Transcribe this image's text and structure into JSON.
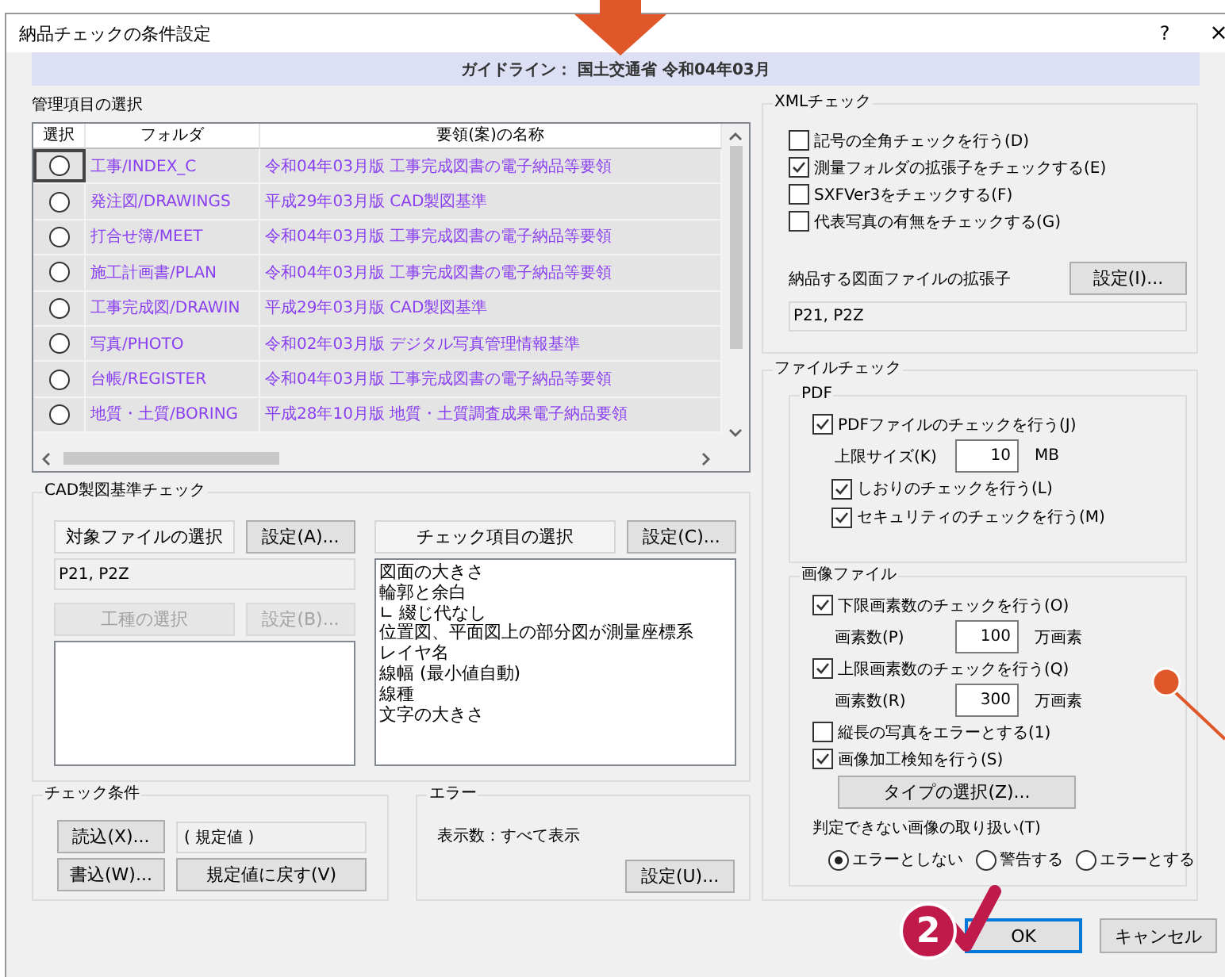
{
  "window": {
    "title": "納品チェックの条件設定",
    "help_button": "?",
    "close_button": "×"
  },
  "guideline": "ガイドライン： 国土交通省 令和04年03月",
  "management": {
    "title": "管理項目の選択",
    "columns": [
      "選択",
      "フォルダ",
      "要領(案)の名称"
    ],
    "rows": [
      {
        "selected": false,
        "focused": true,
        "folder": "工事/INDEX_C",
        "standard": "令和04年03月版 工事完成図書の電子納品等要領"
      },
      {
        "selected": false,
        "focused": false,
        "folder": "発注図/DRAWINGS",
        "standard": "平成29年03月版 CAD製図基準"
      },
      {
        "selected": false,
        "focused": false,
        "folder": "打合せ簿/MEET",
        "standard": "令和04年03月版 工事完成図書の電子納品等要領"
      },
      {
        "selected": false,
        "focused": false,
        "folder": "施工計画書/PLAN",
        "standard": "令和04年03月版 工事完成図書の電子納品等要領"
      },
      {
        "selected": false,
        "focused": false,
        "folder": "工事完成図/DRAWIN",
        "standard": "平成29年03月版 CAD製図基準"
      },
      {
        "selected": false,
        "focused": false,
        "folder": "写真/PHOTO",
        "standard": "令和02年03月版 デジタル写真管理情報基準"
      },
      {
        "selected": false,
        "focused": false,
        "folder": "台帳/REGISTER",
        "standard": "令和04年03月版 工事完成図書の電子納品等要領"
      },
      {
        "selected": false,
        "focused": false,
        "folder": "地質・土質/BORING",
        "standard": "平成28年10月版 地質・土質調査成果電子納品要領"
      }
    ]
  },
  "cad": {
    "title": "CAD製図基準チェック",
    "target_select": {
      "label": "対象ファイルの選択",
      "disabled": false
    },
    "target_settings": {
      "label": "設定(A)...",
      "disabled": false
    },
    "target_value": "P21, P2Z",
    "work_select": {
      "label": "工種の選択",
      "disabled": true
    },
    "work_settings": {
      "label": "設定(B)...",
      "disabled": true
    },
    "check_select": {
      "label": "チェック項目の選択",
      "disabled": false
    },
    "check_settings": {
      "label": "設定(C)...",
      "disabled": false
    },
    "check_items": [
      "図面の大きさ",
      "輪郭と余白",
      "∟ 綴じ代なし",
      "位置図、平面図上の部分図が測量座標系",
      "レイヤ名",
      "線幅 (最小値自動)",
      "線種",
      "文字の大きさ"
    ]
  },
  "conditions": {
    "title": "チェック条件",
    "read_button": "読込(X)...",
    "current": "( 規定値 )",
    "write_button": "書込(W)...",
    "reset_button": "規定値に戻す(V)"
  },
  "error": {
    "title": "エラー",
    "display": "表示数：すべて表示",
    "settings_button": "設定(U)..."
  },
  "xml": {
    "title": "XMLチェック",
    "options": [
      {
        "label": "記号の全角チェックを行う(D)",
        "checked": false
      },
      {
        "label": "測量フォルダの拡張子をチェックする(E)",
        "checked": true
      },
      {
        "label": "SXFVer3をチェックする(F)",
        "checked": false
      },
      {
        "label": "代表写真の有無をチェックする(G)",
        "checked": false
      }
    ],
    "extension_label": "納品する図面ファイルの拡張子",
    "extension_button": "設定(I)...",
    "extension_value": "P21, P2Z"
  },
  "file_check": {
    "title": "ファイルチェック",
    "pdf": {
      "title": "PDF",
      "items": [
        {
          "kind": "checkbox",
          "label": "PDFファイルのチェックを行う(J)",
          "checked": true
        },
        {
          "kind": "field",
          "label": "上限サイズ(K)",
          "value": "10",
          "unit": "MB"
        },
        {
          "kind": "subcheckbox",
          "label": "しおりのチェックを行う(L)",
          "checked": true
        },
        {
          "kind": "subcheckbox",
          "label": "セキュリティのチェックを行う(M)",
          "checked": true
        }
      ]
    },
    "image": {
      "title": "画像ファイル",
      "items": [
        {
          "kind": "checkbox",
          "label": "下限画素数のチェックを行う(O)",
          "checked": true
        },
        {
          "kind": "field",
          "label": "画素数(P)",
          "value": "100",
          "unit": "万画素"
        },
        {
          "kind": "checkbox",
          "label": "上限画素数のチェックを行う(Q)",
          "checked": true
        },
        {
          "kind": "field",
          "label": "画素数(R)",
          "value": "300",
          "unit": "万画素"
        },
        {
          "kind": "checkbox",
          "label": "縦長の写真をエラーとする(1)",
          "checked": false
        },
        {
          "kind": "checkbox",
          "label": "画像加工検知を行う(S)",
          "checked": true
        },
        {
          "kind": "button",
          "label": "タイプの選択(Z)..."
        },
        {
          "kind": "radios",
          "label": "判定できない画像の取り扱い(T)",
          "options": [
            {
              "label": "エラーとしない",
              "selected": true
            },
            {
              "label": "警告する",
              "selected": false
            },
            {
              "label": "エラーとする",
              "selected": false
            }
          ]
        }
      ]
    }
  },
  "buttons": [
    {
      "label": "OK",
      "default": true
    },
    {
      "label": "キャンセル",
      "default": false
    }
  ],
  "annotations": {
    "step_badge": "2"
  }
}
